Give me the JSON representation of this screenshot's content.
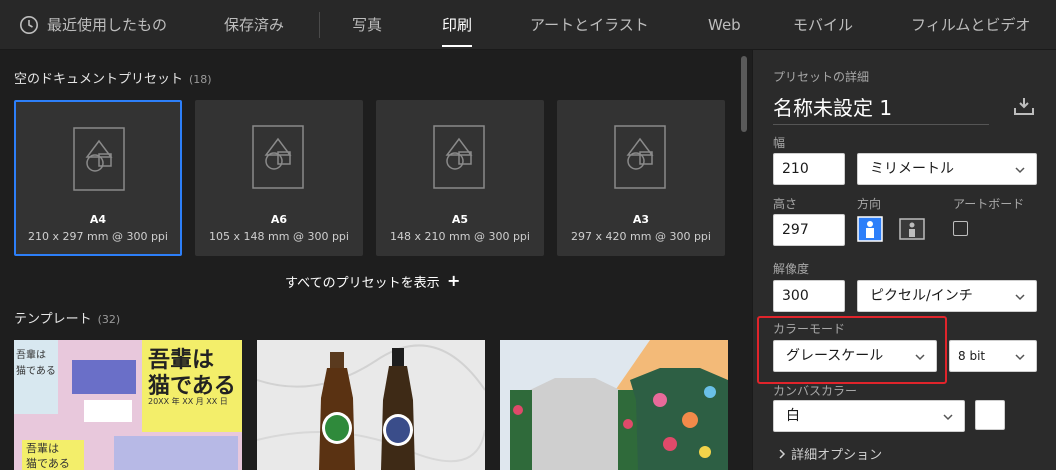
{
  "nav": {
    "tabs": [
      {
        "label": "最近使用したもの"
      },
      {
        "label": "保存済み"
      },
      {
        "label": "写真"
      },
      {
        "label": "印刷"
      },
      {
        "label": "アートとイラスト"
      },
      {
        "label": "Web"
      },
      {
        "label": "モバイル"
      },
      {
        "label": "フィルムとビデオ"
      }
    ],
    "active_tab": "印刷"
  },
  "presets": {
    "title": "空のドキュメントプリセット",
    "count": "(18)",
    "items": [
      {
        "name": "A4",
        "size": "210 x 297 mm @ 300 ppi"
      },
      {
        "name": "A6",
        "size": "105 x 148 mm @ 300 ppi"
      },
      {
        "name": "A5",
        "size": "148 x 210 mm @ 300 ppi"
      },
      {
        "name": "A3",
        "size": "297 x 420 mm @ 300 ppi"
      }
    ],
    "show_all": "すべてのプリセットを表示",
    "plus": "+"
  },
  "templates": {
    "title": "テンプレート",
    "count": "(32)",
    "thumb1": {
      "big_text_line1": "吾輩は",
      "big_text_line2": "猫である",
      "date_text": "20XX 年 XX 月 XX 日",
      "small_text_1": "吾輩は",
      "small_text_2": "猫である",
      "small_text_3": "吾輩は",
      "small_text_4": "猫である"
    }
  },
  "details": {
    "header": "プリセットの詳細",
    "doc_name": "名称未設定 1",
    "width_label": "幅",
    "width_value": "210",
    "unit_value": "ミリメートル",
    "height_label": "高さ",
    "height_value": "297",
    "orientation_label": "方向",
    "artboard_label": "アートボード",
    "resolution_label": "解像度",
    "resolution_value": "300",
    "resolution_unit": "ピクセル/インチ",
    "color_mode_label": "カラーモード",
    "color_mode_value": "グレースケール",
    "bit_depth_value": "8 bit",
    "canvas_color_label": "カンバスカラー",
    "canvas_color_value": "白",
    "advanced": "詳細オプション"
  },
  "colors": {
    "accent": "#2d7ff9",
    "highlight": "#e0242b",
    "panel_bg": "#2b2b2b"
  }
}
